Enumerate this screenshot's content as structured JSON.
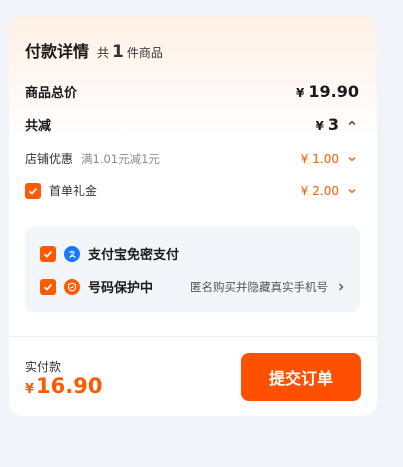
{
  "header": {
    "title": "付款详情",
    "count_prefix": "共",
    "count": "1",
    "count_suffix": "件商品"
  },
  "total_goods": {
    "label": "商品总价",
    "currency": "¥",
    "amount": "19.90"
  },
  "discount_total": {
    "label": "共减",
    "currency": "¥",
    "amount": "3",
    "icon": "chevron-up-icon"
  },
  "shop_discount": {
    "label": "店铺优惠",
    "detail": "满1.01元减1元",
    "currency": "¥",
    "amount": "1.00",
    "icon": "chevron-down-icon"
  },
  "first_order_gift": {
    "label": "首单礼金",
    "checked": true,
    "currency": "¥",
    "amount": "2.00",
    "icon": "chevron-down-icon"
  },
  "services": [
    {
      "label": "支付宝免密支付",
      "checked": true,
      "icon": "alipay-icon",
      "icon_color": "#1677ff"
    },
    {
      "label": "号码保护中",
      "checked": true,
      "icon": "shield-icon",
      "icon_color": "#ff5a00",
      "description": "匿名购买并隐藏真实手机号"
    }
  ],
  "footer": {
    "label": "实付款",
    "currency": "¥",
    "amount": "16.90",
    "submit_label": "提交订单"
  },
  "colors": {
    "accent": "#ff5000",
    "price": "#ff5a00",
    "panel": "#f2f5f9"
  }
}
